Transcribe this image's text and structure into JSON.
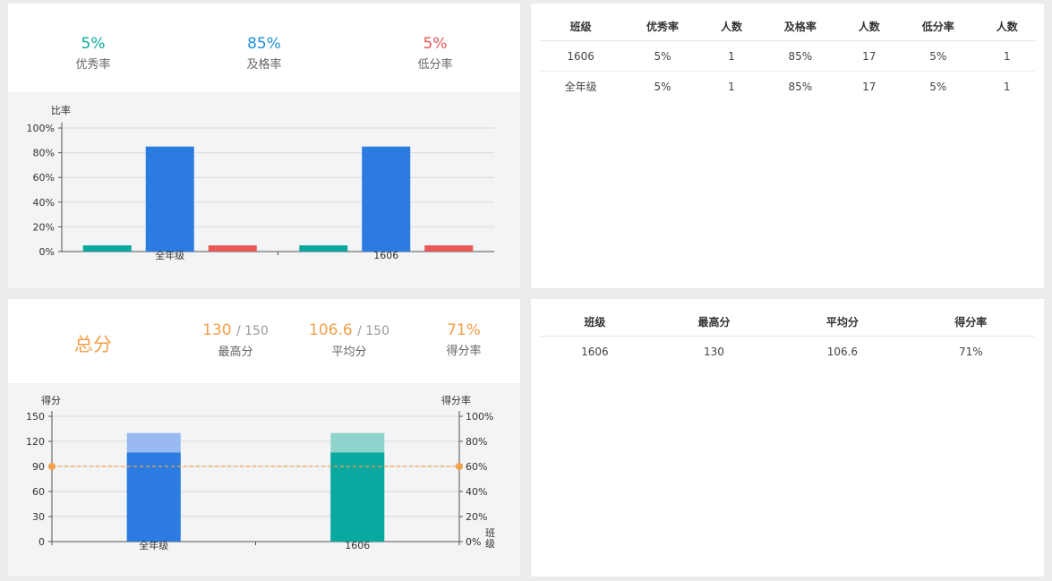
{
  "colors": {
    "excellent": "#0aa89e",
    "pass": "#2b7be0",
    "low": "#e95656",
    "accent": "#f2a04a",
    "teal_light": "#8fd4cc",
    "blue_light": "#99baf0"
  },
  "top_stats": [
    {
      "value": "5%",
      "label": "优秀率",
      "color": "#0aa89e"
    },
    {
      "value": "85%",
      "label": "及格率",
      "color": "#1f8ed6"
    },
    {
      "value": "5%",
      "label": "低分率",
      "color": "#e95656"
    }
  ],
  "rate_table": {
    "headers": [
      "班级",
      "优秀率",
      "人数",
      "及格率",
      "人数",
      "低分率",
      "人数"
    ],
    "rows": [
      [
        "1606",
        "5%",
        "1",
        "85%",
        "17",
        "5%",
        "1"
      ],
      [
        "全年级",
        "5%",
        "1",
        "85%",
        "17",
        "5%",
        "1"
      ]
    ]
  },
  "score_summary": {
    "title": "总分",
    "max": {
      "value": "130",
      "total": "/ 150",
      "label": "最高分"
    },
    "avg": {
      "value": "106.6",
      "total": "/ 150",
      "label": "平均分"
    },
    "rate": {
      "value": "71%",
      "label": "得分率"
    }
  },
  "score_table": {
    "headers": [
      "班级",
      "最高分",
      "平均分",
      "得分率"
    ],
    "rows": [
      [
        "1606",
        "130",
        "106.6",
        "71%"
      ]
    ]
  },
  "chart_data": [
    {
      "type": "bar",
      "ylabel": "比率",
      "ylim": [
        0,
        100
      ],
      "y_ticks": [
        "0%",
        "20%",
        "40%",
        "60%",
        "80%",
        "100%"
      ],
      "categories": [
        "全年级",
        "1606"
      ],
      "series": [
        {
          "values": [
            5,
            5
          ],
          "color": "#0aa89e"
        },
        {
          "values": [
            85,
            85
          ],
          "color": "#2b7be0"
        },
        {
          "values": [
            5,
            5
          ],
          "color": "#e95656"
        }
      ]
    },
    {
      "type": "bar",
      "ylabel": "得分",
      "ylabel_right": "得分率",
      "xlabel": "班级",
      "ylim": [
        0,
        150
      ],
      "y_ticks": [
        "0",
        "30",
        "60",
        "90",
        "120",
        "150"
      ],
      "y_ticks_right": [
        "0%",
        "20%",
        "40%",
        "60%",
        "80%",
        "100%"
      ],
      "categories": [
        "全年级",
        "1606"
      ],
      "series": [
        {
          "values": [
            130,
            130
          ]
        },
        {
          "values": [
            106.6,
            106.6
          ]
        }
      ],
      "reference_line": 60
    }
  ]
}
